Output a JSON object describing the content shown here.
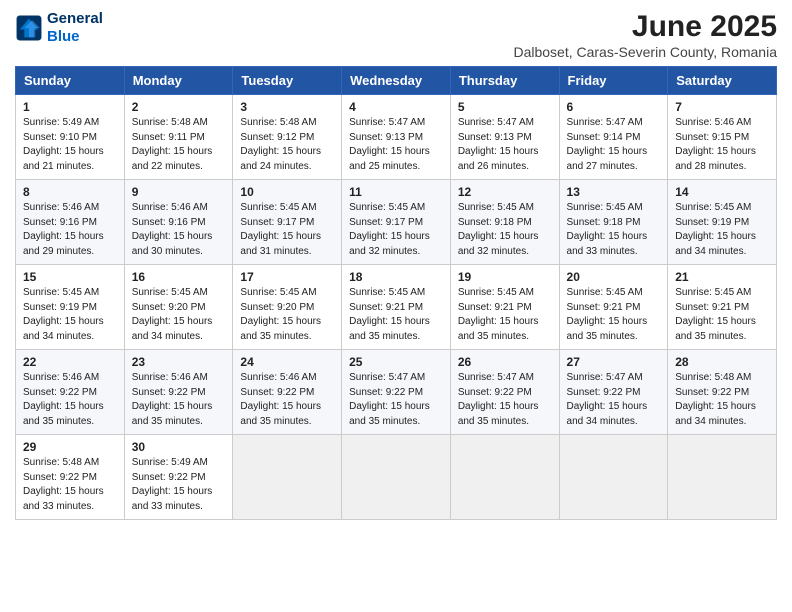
{
  "logo": {
    "line1": "General",
    "line2": "Blue"
  },
  "title": "June 2025",
  "subtitle": "Dalboset, Caras-Severin County, Romania",
  "headers": [
    "Sunday",
    "Monday",
    "Tuesday",
    "Wednesday",
    "Thursday",
    "Friday",
    "Saturday"
  ],
  "weeks": [
    [
      {
        "day": "1",
        "sunrise": "5:49 AM",
        "sunset": "9:10 PM",
        "daylight": "15 hours and 21 minutes."
      },
      {
        "day": "2",
        "sunrise": "5:48 AM",
        "sunset": "9:11 PM",
        "daylight": "15 hours and 22 minutes."
      },
      {
        "day": "3",
        "sunrise": "5:48 AM",
        "sunset": "9:12 PM",
        "daylight": "15 hours and 24 minutes."
      },
      {
        "day": "4",
        "sunrise": "5:47 AM",
        "sunset": "9:13 PM",
        "daylight": "15 hours and 25 minutes."
      },
      {
        "day": "5",
        "sunrise": "5:47 AM",
        "sunset": "9:13 PM",
        "daylight": "15 hours and 26 minutes."
      },
      {
        "day": "6",
        "sunrise": "5:47 AM",
        "sunset": "9:14 PM",
        "daylight": "15 hours and 27 minutes."
      },
      {
        "day": "7",
        "sunrise": "5:46 AM",
        "sunset": "9:15 PM",
        "daylight": "15 hours and 28 minutes."
      }
    ],
    [
      {
        "day": "8",
        "sunrise": "5:46 AM",
        "sunset": "9:16 PM",
        "daylight": "15 hours and 29 minutes."
      },
      {
        "day": "9",
        "sunrise": "5:46 AM",
        "sunset": "9:16 PM",
        "daylight": "15 hours and 30 minutes."
      },
      {
        "day": "10",
        "sunrise": "5:45 AM",
        "sunset": "9:17 PM",
        "daylight": "15 hours and 31 minutes."
      },
      {
        "day": "11",
        "sunrise": "5:45 AM",
        "sunset": "9:17 PM",
        "daylight": "15 hours and 32 minutes."
      },
      {
        "day": "12",
        "sunrise": "5:45 AM",
        "sunset": "9:18 PM",
        "daylight": "15 hours and 32 minutes."
      },
      {
        "day": "13",
        "sunrise": "5:45 AM",
        "sunset": "9:18 PM",
        "daylight": "15 hours and 33 minutes."
      },
      {
        "day": "14",
        "sunrise": "5:45 AM",
        "sunset": "9:19 PM",
        "daylight": "15 hours and 34 minutes."
      }
    ],
    [
      {
        "day": "15",
        "sunrise": "5:45 AM",
        "sunset": "9:19 PM",
        "daylight": "15 hours and 34 minutes."
      },
      {
        "day": "16",
        "sunrise": "5:45 AM",
        "sunset": "9:20 PM",
        "daylight": "15 hours and 34 minutes."
      },
      {
        "day": "17",
        "sunrise": "5:45 AM",
        "sunset": "9:20 PM",
        "daylight": "15 hours and 35 minutes."
      },
      {
        "day": "18",
        "sunrise": "5:45 AM",
        "sunset": "9:21 PM",
        "daylight": "15 hours and 35 minutes."
      },
      {
        "day": "19",
        "sunrise": "5:45 AM",
        "sunset": "9:21 PM",
        "daylight": "15 hours and 35 minutes."
      },
      {
        "day": "20",
        "sunrise": "5:45 AM",
        "sunset": "9:21 PM",
        "daylight": "15 hours and 35 minutes."
      },
      {
        "day": "21",
        "sunrise": "5:45 AM",
        "sunset": "9:21 PM",
        "daylight": "15 hours and 35 minutes."
      }
    ],
    [
      {
        "day": "22",
        "sunrise": "5:46 AM",
        "sunset": "9:22 PM",
        "daylight": "15 hours and 35 minutes."
      },
      {
        "day": "23",
        "sunrise": "5:46 AM",
        "sunset": "9:22 PM",
        "daylight": "15 hours and 35 minutes."
      },
      {
        "day": "24",
        "sunrise": "5:46 AM",
        "sunset": "9:22 PM",
        "daylight": "15 hours and 35 minutes."
      },
      {
        "day": "25",
        "sunrise": "5:47 AM",
        "sunset": "9:22 PM",
        "daylight": "15 hours and 35 minutes."
      },
      {
        "day": "26",
        "sunrise": "5:47 AM",
        "sunset": "9:22 PM",
        "daylight": "15 hours and 35 minutes."
      },
      {
        "day": "27",
        "sunrise": "5:47 AM",
        "sunset": "9:22 PM",
        "daylight": "15 hours and 34 minutes."
      },
      {
        "day": "28",
        "sunrise": "5:48 AM",
        "sunset": "9:22 PM",
        "daylight": "15 hours and 34 minutes."
      }
    ],
    [
      {
        "day": "29",
        "sunrise": "5:48 AM",
        "sunset": "9:22 PM",
        "daylight": "15 hours and 33 minutes."
      },
      {
        "day": "30",
        "sunrise": "5:49 AM",
        "sunset": "9:22 PM",
        "daylight": "15 hours and 33 minutes."
      },
      null,
      null,
      null,
      null,
      null
    ]
  ]
}
